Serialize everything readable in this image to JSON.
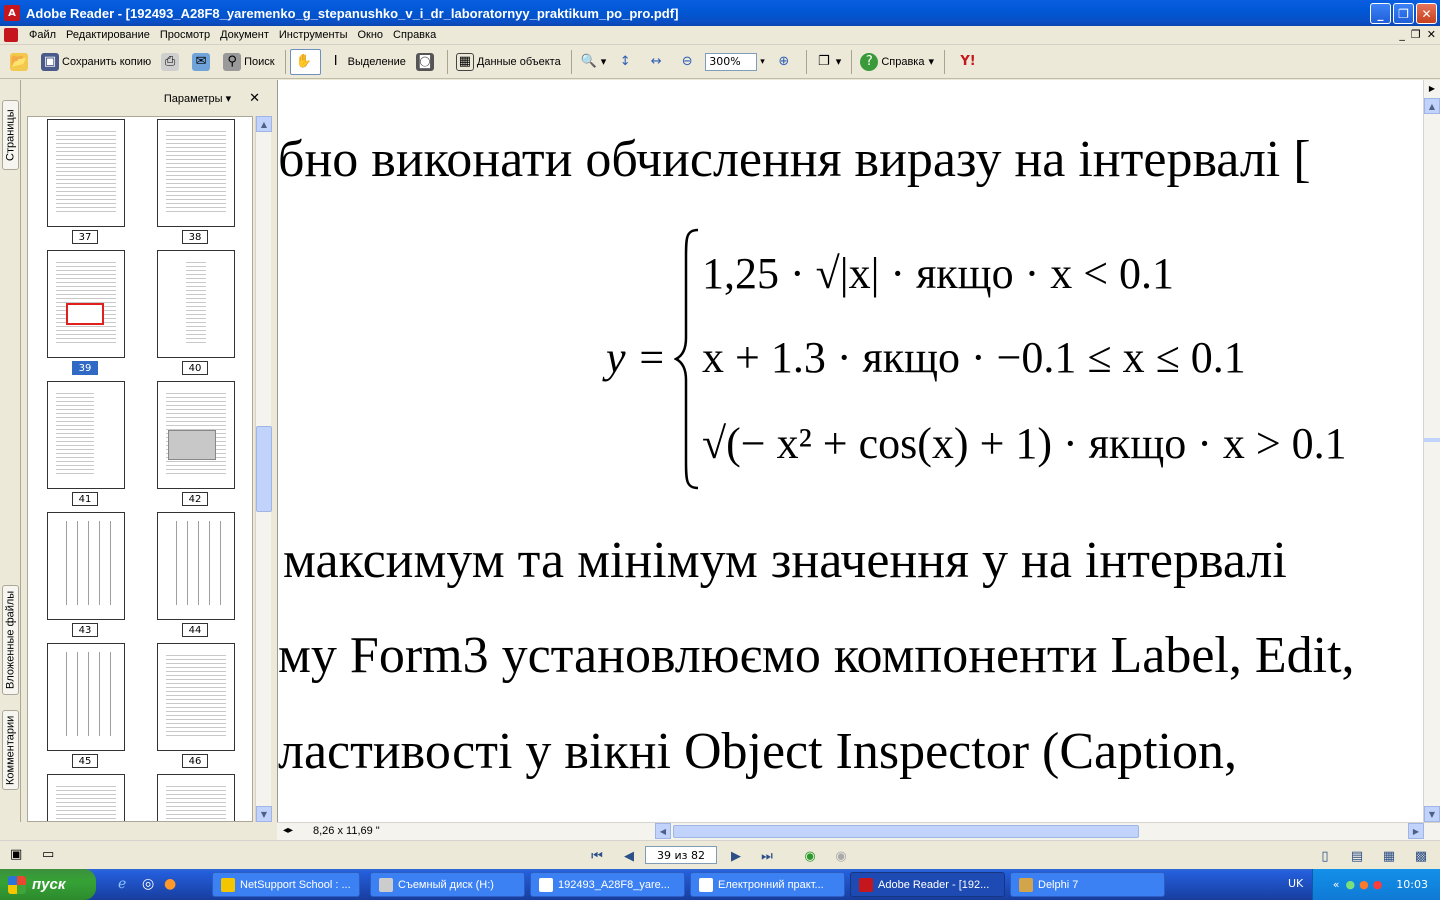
{
  "window": {
    "app_title": "Adobe Reader - [192493_A28F8_yaremenko_g_stepanushko_v_i_dr_laboratornyy_praktikum_po_pro.pdf]"
  },
  "menu": [
    "Файл",
    "Редактирование",
    "Просмотр",
    "Документ",
    "Инструменты",
    "Окно",
    "Справка"
  ],
  "toolbar": {
    "save_copy": "Сохранить копию",
    "search": "Поиск",
    "select": "Выделение",
    "object_data": "Данные объекта",
    "zoom": "300%",
    "help": "Справка"
  },
  "side_tabs": {
    "pages": "Страницы",
    "attachments": "Вложенные файлы",
    "comments": "Комментарии"
  },
  "panel": {
    "options": "Параметры",
    "thumbnails": [
      {
        "num": "37",
        "selected": false
      },
      {
        "num": "38",
        "selected": false
      },
      {
        "num": "39",
        "selected": true
      },
      {
        "num": "40",
        "selected": false
      },
      {
        "num": "41",
        "selected": false
      },
      {
        "num": "42",
        "selected": false
      },
      {
        "num": "43",
        "selected": false
      },
      {
        "num": "44",
        "selected": false
      },
      {
        "num": "45",
        "selected": false
      },
      {
        "num": "46",
        "selected": false
      }
    ]
  },
  "document": {
    "line1": "бно  виконати обчислення виразу  на інтервалі [",
    "line2": "максимум  та мінімум значення  у  на інтервалі",
    "line3": "му Form3 установлюємо компоненти Label, Edit,",
    "line4": "ластивості  у  вікні  Object  Inspector  (Caption,",
    "formula": {
      "lhs": "y =",
      "case1": "1,25 · √|x| · якщо · x < 0.1",
      "case2": "x + 1.3 · якщо · −0.1 ≤ x ≤ 0.1",
      "case3": "√(− x² + cos(x) + 1) · якщо · x > 0.1"
    }
  },
  "status": {
    "page_size": "8,26 x 11,69 \"",
    "page_field": "39 из 82"
  },
  "taskbar": {
    "start": "пуск",
    "tasks": [
      "NetSupport School : ...",
      "Съемный диск (H:)",
      "192493_A28F8_yare...",
      "Електронний практ...",
      "Adobe Reader - [192...",
      "Delphi 7"
    ],
    "lang": "UK",
    "clock": "10:03"
  }
}
